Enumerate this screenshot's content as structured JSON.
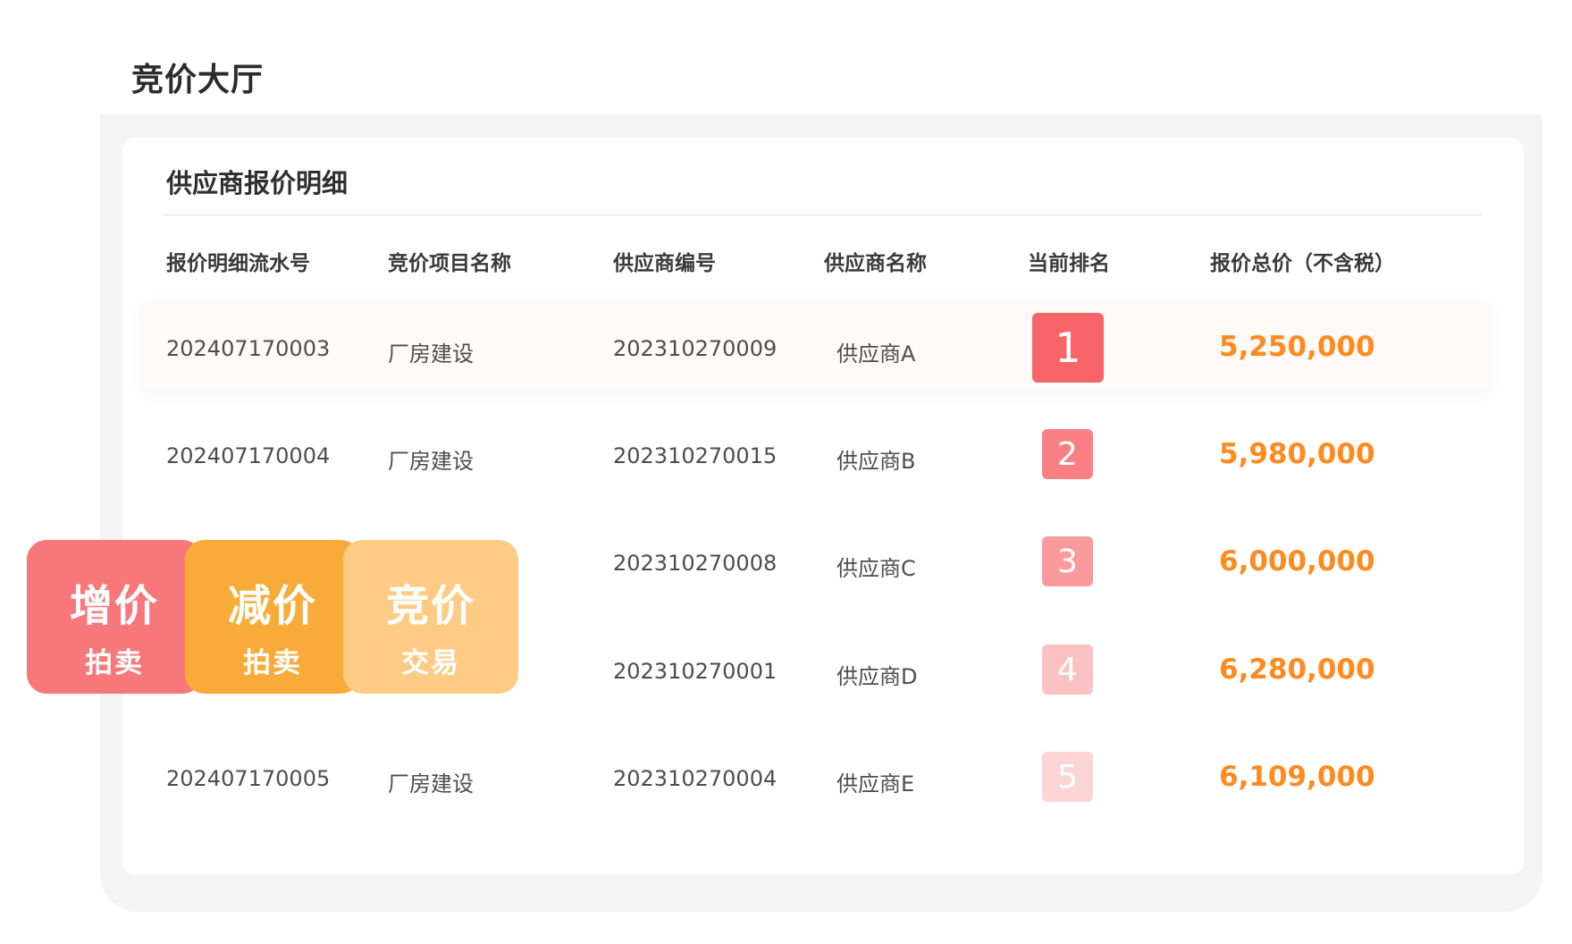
{
  "page": {
    "title": "竞价大厅"
  },
  "card": {
    "title": "供应商报价明细"
  },
  "table": {
    "headers": [
      "报价明细流水号",
      "竞价项目名称",
      "供应商编号",
      "供应商名称",
      "当前排名",
      "报价总价（不含税）"
    ],
    "rows": [
      {
        "serial": "202407170003",
        "project": "厂房建设",
        "supplier_code": "202310270009",
        "supplier_name": "供应商A",
        "rank": "1",
        "price": "5,250,000",
        "rank_color": "#f96469"
      },
      {
        "serial": "202407170004",
        "project": "厂房建设",
        "supplier_code": "202310270015",
        "supplier_name": "供应商B",
        "rank": "2",
        "price": "5,980,000",
        "rank_color": "#fa8083"
      },
      {
        "serial": "",
        "project": "",
        "supplier_code": "202310270008",
        "supplier_name": "供应商C",
        "rank": "3",
        "price": "6,000,000",
        "rank_color": "#fb9a9c"
      },
      {
        "serial": "",
        "project": "",
        "supplier_code": "202310270001",
        "supplier_name": "供应商D",
        "rank": "4",
        "price": "6,280,000",
        "rank_color": "#fcc2c3"
      },
      {
        "serial": "202407170005",
        "project": "厂房建设",
        "supplier_code": "202310270004",
        "supplier_name": "供应商E",
        "rank": "5",
        "price": "6,109,000",
        "rank_color": "#fcd4d5"
      }
    ]
  },
  "promos": [
    {
      "main": "增价",
      "sub": "拍卖",
      "color": "#f8777b"
    },
    {
      "main": "减价",
      "sub": "拍卖",
      "color": "#f9ab39"
    },
    {
      "main": "竞价",
      "sub": "交易",
      "color": "#fecb85"
    }
  ],
  "colors": {
    "accent_price": "#ff8a1f",
    "panel_bg": "#f4f4f4"
  }
}
